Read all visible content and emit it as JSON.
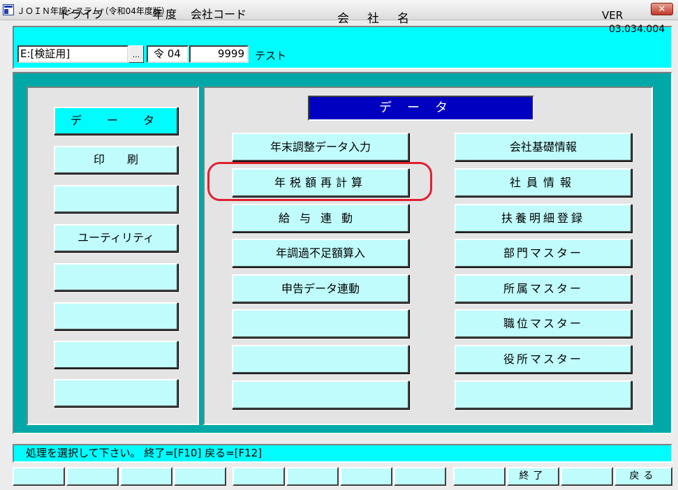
{
  "window": {
    "title": "ＪＯＩＮ年調システム（令和04年度版）",
    "close_glyph": "✕"
  },
  "header": {
    "drive_label": "ドライブ",
    "year_label": "年度",
    "company_code_label": "会社コード",
    "company_name_label": "会社名",
    "ver_label": "VER",
    "ver_value": "03.034.004",
    "drive_value": "E:[検証用]",
    "drive_browse_label": "...",
    "year_value": "令 04",
    "company_code_value": "9999",
    "company_name_value": "テスト"
  },
  "left_menu": {
    "items": [
      {
        "label": "デ　ー　タ",
        "selected": true
      },
      {
        "label": "印　　刷",
        "selected": false
      },
      {
        "label": "",
        "selected": false
      },
      {
        "label": "ユーティリティ",
        "selected": false
      },
      {
        "label": "",
        "selected": false
      },
      {
        "label": "",
        "selected": false
      },
      {
        "label": "",
        "selected": false
      },
      {
        "label": "",
        "selected": false
      }
    ]
  },
  "main_panel": {
    "header": "データ",
    "left_column": [
      {
        "label": "年末調整データ入力"
      },
      {
        "label": "年税額再計算"
      },
      {
        "label": "給与連動"
      },
      {
        "label": "年調過不足額算入"
      },
      {
        "label": "申告データ連動"
      },
      {
        "label": ""
      },
      {
        "label": ""
      },
      {
        "label": ""
      }
    ],
    "right_column": [
      {
        "label": "会社基礎情報"
      },
      {
        "label": "社員情報"
      },
      {
        "label": "扶養明細登録"
      },
      {
        "label": "部門マスター"
      },
      {
        "label": "所属マスター"
      },
      {
        "label": "職位マスター"
      },
      {
        "label": "役所マスター"
      },
      {
        "label": ""
      }
    ],
    "highlighted": "年税額再計算",
    "highlight_color": "#e02030"
  },
  "status": {
    "message": "処理を選択して下さい。 終了=[F10] 戻る=[F12]"
  },
  "function_keys": [
    {
      "label": ""
    },
    {
      "label": ""
    },
    {
      "label": ""
    },
    {
      "label": ""
    },
    {
      "label": ""
    },
    {
      "label": ""
    },
    {
      "label": ""
    },
    {
      "label": ""
    },
    {
      "label": ""
    },
    {
      "label": "終了"
    },
    {
      "label": ""
    },
    {
      "label": "戻る"
    }
  ],
  "colors": {
    "cyan": "#00fcfc",
    "button_cyan": "#c0fcfc",
    "teal": "#00a8a8",
    "header_blue": "#0000c0"
  }
}
